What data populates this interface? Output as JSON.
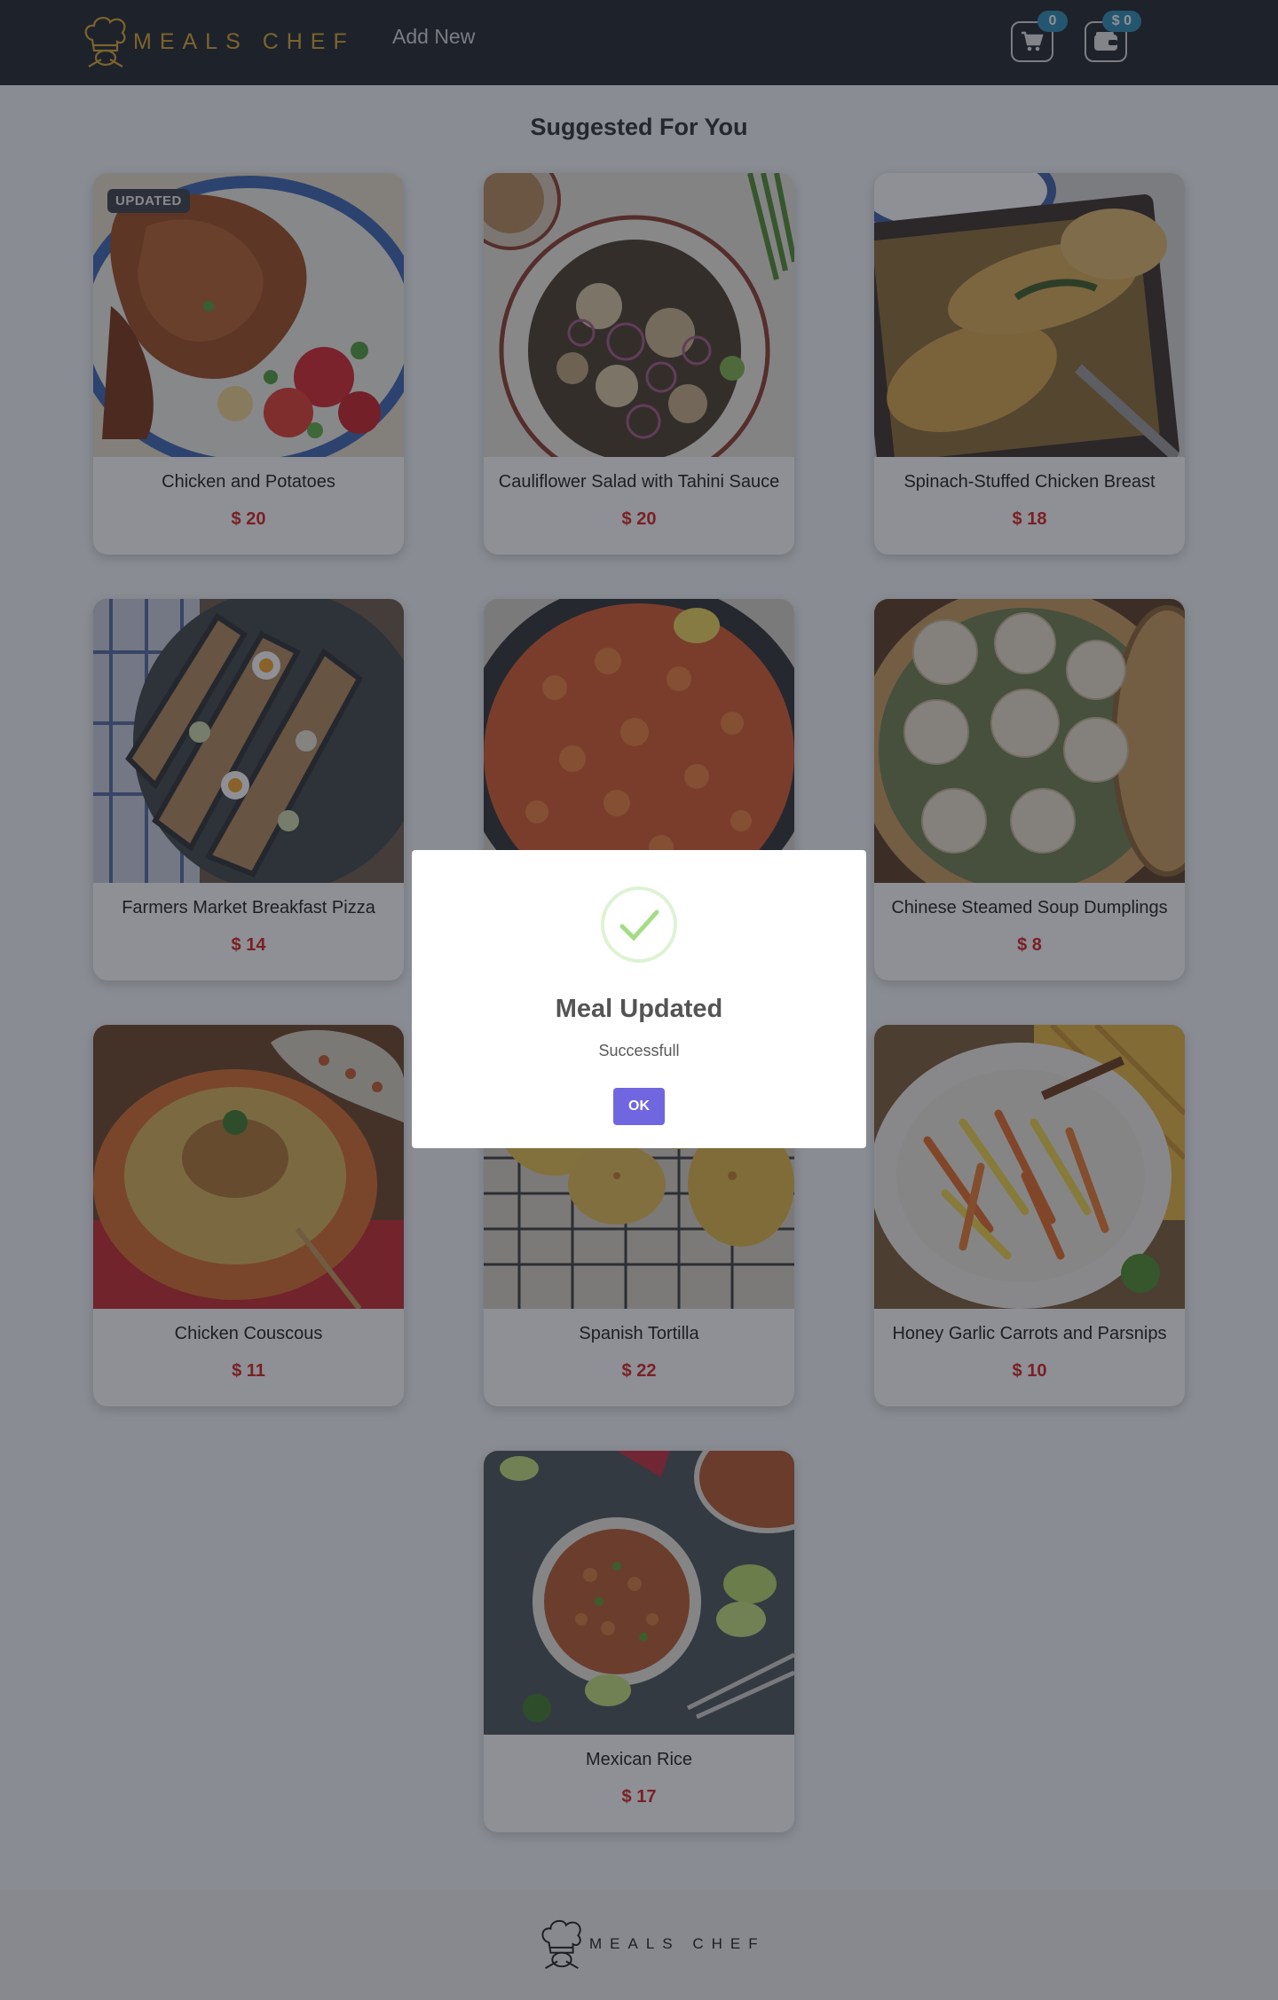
{
  "header": {
    "brand": "MEALS CHEF",
    "add_new": "Add New",
    "cart_count": "0",
    "wallet_balance": "$ 0"
  },
  "main": {
    "section_title": "Suggested For You",
    "updated_badge": "UPDATED",
    "meals": [
      {
        "name": "Chicken and Potatoes",
        "price": "$ 20",
        "updated": true,
        "image": "roast-chicken"
      },
      {
        "name": "Cauliflower Salad with Tahini Sauce",
        "price": "$ 20",
        "updated": false,
        "image": "cauliflower-salad"
      },
      {
        "name": "Spinach-Stuffed Chicken Breast",
        "price": "$ 18",
        "updated": false,
        "image": "stuffed-chicken"
      },
      {
        "name": "Farmers Market Breakfast Pizza",
        "price": "$ 14",
        "updated": false,
        "image": "breakfast-pizza"
      },
      {
        "name": "",
        "price": "",
        "updated": false,
        "image": "paella"
      },
      {
        "name": "Chinese Steamed Soup Dumplings",
        "price": "$ 8",
        "updated": false,
        "image": "dumplings"
      },
      {
        "name": "Chicken Couscous",
        "price": "$ 11",
        "updated": false,
        "image": "couscous-tagine"
      },
      {
        "name": "Spanish Tortilla",
        "price": "$ 22",
        "updated": false,
        "image": "tortilla-muffins"
      },
      {
        "name": "Honey Garlic Carrots and Parsnips",
        "price": "$ 10",
        "updated": false,
        "image": "carrot-fries"
      },
      {
        "name": "Mexican Rice",
        "price": "$ 17",
        "updated": false,
        "image": "mexican-rice"
      }
    ]
  },
  "footer": {
    "brand": "MEALS CHEF"
  },
  "modal": {
    "title": "Meal Updated",
    "message": "Successfull",
    "ok_label": "OK",
    "icon": "check-icon"
  },
  "colors": {
    "navbar": "#1e222b",
    "brand_gold": "#d9a72f",
    "price_red": "#d41e1e",
    "badge_blue": "#2d8ab3",
    "ok_button": "#7066e0",
    "check_green": "#a5dc86"
  }
}
